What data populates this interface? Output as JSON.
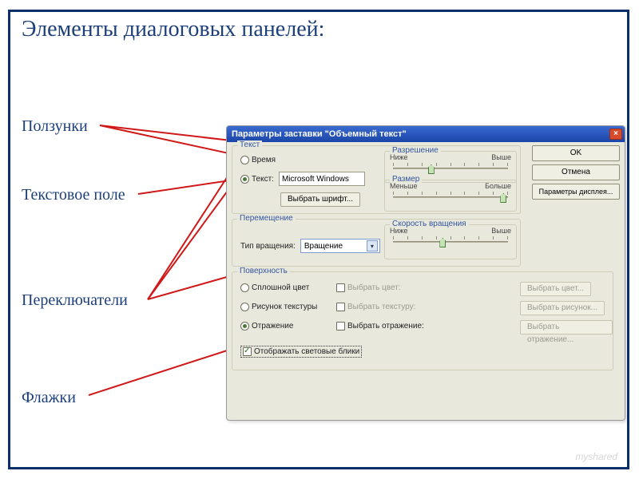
{
  "slide": {
    "title": "Элементы диалоговых панелей:",
    "labels": {
      "sliders": "Ползунки",
      "textfield": "Текстовое поле",
      "radios": "Переключатели",
      "checks": "Флажки"
    },
    "watermark": "myshared"
  },
  "dialog": {
    "title": "Параметры заставки \"Объемный текст\"",
    "close_glyph": "×",
    "buttons": {
      "ok": "OK",
      "cancel": "Отмена",
      "display_params": "Параметры дисплея..."
    },
    "groups": {
      "text": {
        "title": "Текст",
        "radio_time": "Время",
        "radio_text": "Текст:",
        "text_value": "Microsoft Windows",
        "choose_font": "Выбрать шрифт...",
        "resolution": {
          "title": "Разрешение",
          "low": "Ниже",
          "high": "Выше",
          "pos": 30
        },
        "size": {
          "title": "Размер",
          "low": "Меньше",
          "high": "Больше",
          "pos": 92
        }
      },
      "move": {
        "title": "Перемещение",
        "spin_type_label": "Тип вращения:",
        "spin_type_value": "Вращение",
        "speed": {
          "title": "Скорость вращения",
          "low": "Ниже",
          "high": "Выше",
          "pos": 40
        }
      },
      "surface": {
        "title": "Поверхность",
        "radio_solid": "Сплошной цвет",
        "radio_texture": "Рисунок текстуры",
        "radio_reflect": "Отражение",
        "choose_color_chk": "Выбрать цвет:",
        "choose_texture_chk": "Выбрать текстуру:",
        "choose_reflect_chk": "Выбрать отражение:",
        "btn_color": "Выбрать цвет...",
        "btn_texture": "Выбрать рисунок...",
        "btn_reflect": "Выбрать отражение...",
        "chk_specular": "Отображать световые блики"
      }
    }
  }
}
